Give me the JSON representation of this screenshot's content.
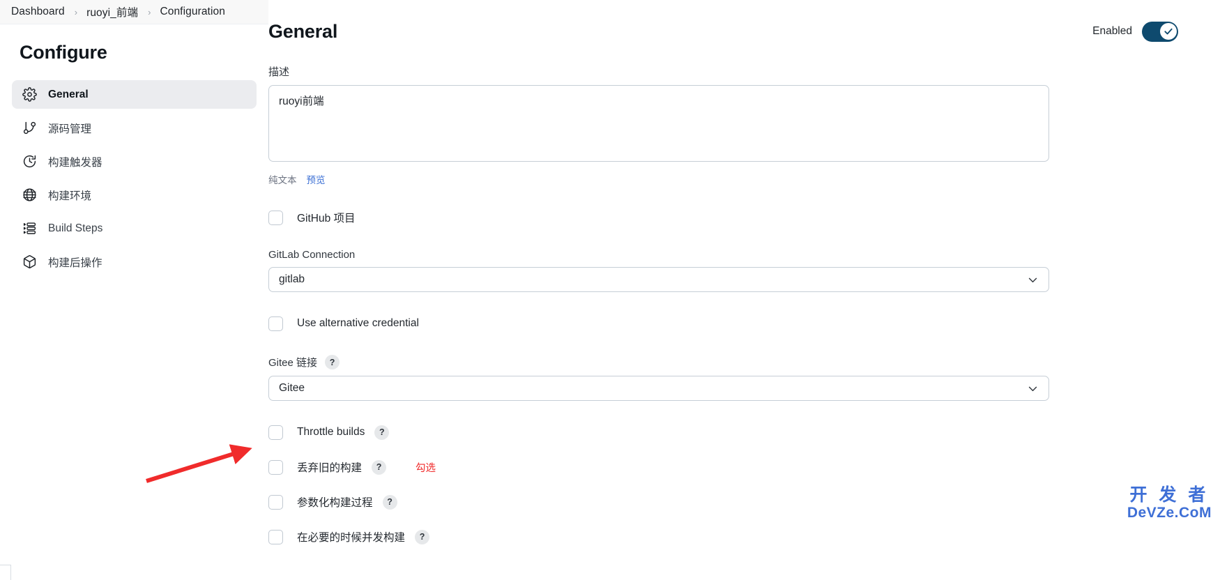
{
  "breadcrumb": {
    "items": [
      {
        "label": "Dashboard"
      },
      {
        "label": "ruoyi_前端"
      },
      {
        "label": "Configuration"
      }
    ],
    "separator": "›"
  },
  "sidebar": {
    "title": "Configure",
    "items": [
      {
        "label": "General",
        "icon": "gear-icon",
        "active": true
      },
      {
        "label": "源码管理",
        "icon": "git-branch-icon",
        "active": false
      },
      {
        "label": "构建触发器",
        "icon": "clock-icon",
        "active": false
      },
      {
        "label": "构建环境",
        "icon": "globe-icon",
        "active": false
      },
      {
        "label": "Build Steps",
        "icon": "list-steps-icon",
        "active": false
      },
      {
        "label": "构建后操作",
        "icon": "package-icon",
        "active": false
      }
    ]
  },
  "main": {
    "title": "General",
    "enabled_label": "Enabled",
    "enabled": true,
    "toggle_color": "#0e4a6e",
    "description": {
      "label": "描述",
      "value": "ruoyi前端",
      "placeholder": "",
      "plain_text_label": "纯文本",
      "preview_label": "预览"
    },
    "github_project": {
      "label": "GitHub 项目",
      "checked": false
    },
    "gitlab_connection": {
      "label": "GitLab Connection",
      "value": "gitlab"
    },
    "use_alternative_credential": {
      "label": "Use alternative credential",
      "checked": false
    },
    "gitee_link": {
      "label": "Gitee 链接",
      "help": "?",
      "value": "Gitee"
    },
    "throttle_builds": {
      "label": "Throttle builds",
      "help": "?",
      "checked": false
    },
    "discard_old_builds": {
      "label": "丢弃旧的构建",
      "help": "?",
      "checked": false,
      "annotation": "勾选"
    },
    "parameterized_build": {
      "label": "参数化构建过程",
      "help": "?",
      "checked": false
    },
    "concurrent_build": {
      "label": "在必要的时候并发构建",
      "help": "?",
      "checked": false
    }
  },
  "watermark": {
    "line1": "开 发 者",
    "line2": "DeVZe.CoM",
    "color": "#3e6fd6"
  },
  "annotation": {
    "arrow_color": "#f02b2b"
  }
}
